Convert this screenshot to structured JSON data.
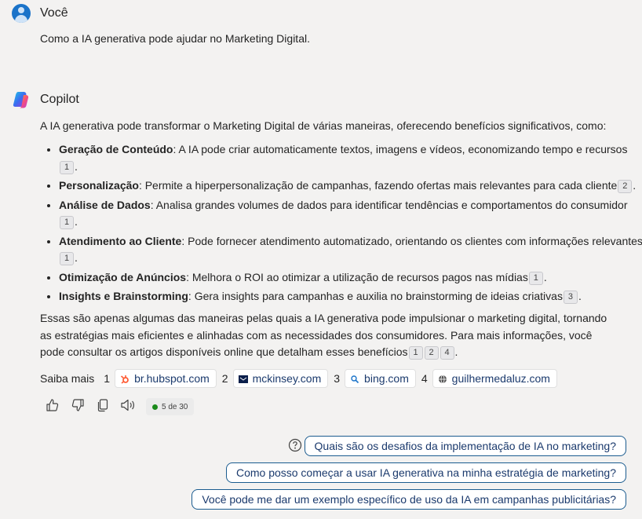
{
  "user": {
    "name": "Você",
    "message": "Como a IA generativa pode ajudar no Marketing Digital."
  },
  "copilot": {
    "name": "Copilot",
    "intro": "A IA generativa pode transformar o Marketing Digital de várias maneiras, oferecendo benefícios significativos, como:",
    "bullets": [
      {
        "title": "Geração de Conteúdo",
        "text": ": A IA pode criar automaticamente textos, imagens e vídeos, economizando tempo e recursos",
        "cites": [
          "1"
        ]
      },
      {
        "title": "Personalização",
        "text": ": Permite a hiperpersonalização de campanhas, fazendo ofertas mais relevantes para cada cliente",
        "cites": [
          "2"
        ]
      },
      {
        "title": "Análise de Dados",
        "text": ": Analisa grandes volumes de dados para identificar tendências e comportamentos do consumidor",
        "cites": [
          "1"
        ]
      },
      {
        "title": "Atendimento ao Cliente",
        "text": ": Pode fornecer atendimento automatizado, orientando os clientes com informações relevantes",
        "cites": [
          "1"
        ]
      },
      {
        "title": "Otimização de Anúncios",
        "text": ": Melhora o ROI ao otimizar a utilização de recursos pagos nas mídias",
        "cites": [
          "1"
        ]
      },
      {
        "title": "Insights e Brainstorming",
        "text": ": Gera insights para campanhas e auxilia no brainstorming de ideias criativas",
        "cites": [
          "3"
        ]
      }
    ],
    "conclusion": "Essas são apenas algumas das maneiras pelas quais a IA generativa pode impulsionar o marketing digital, tornando as estratégias mais eficientes e alinhadas com as necessidades dos consumidores. Para mais informações, você pode consultar os artigos disponíveis online que detalham esses benefícios",
    "conclusion_cites": [
      "1",
      "2",
      "4"
    ],
    "period": "."
  },
  "learn_more": {
    "label": "Saiba mais",
    "sources": [
      {
        "num": "1",
        "domain": "br.hubspot.com",
        "icon": "hubspot-icon",
        "color": "#ff5c35"
      },
      {
        "num": "2",
        "domain": "mckinsey.com",
        "icon": "mckinsey-icon",
        "color": "#0b1f4b"
      },
      {
        "num": "3",
        "domain": "bing.com",
        "icon": "search-icon",
        "color": "#1a73c9"
      },
      {
        "num": "4",
        "domain": "guilhermedaluz.com",
        "icon": "globe-icon",
        "color": "#555555"
      }
    ]
  },
  "feedback": {
    "counter": "5 de 30"
  },
  "suggestions": [
    "Quais são os desafios da implementação de IA no marketing?",
    "Como posso começar a usar IA generativa na minha estratégia de marketing?",
    "Você pode me dar um exemplo específico de uso da IA em campanhas publicitárias?"
  ],
  "colors": {
    "accent": "#1b5c8f",
    "background": "#f3f2f1",
    "status_dot": "#1a8a1a"
  }
}
